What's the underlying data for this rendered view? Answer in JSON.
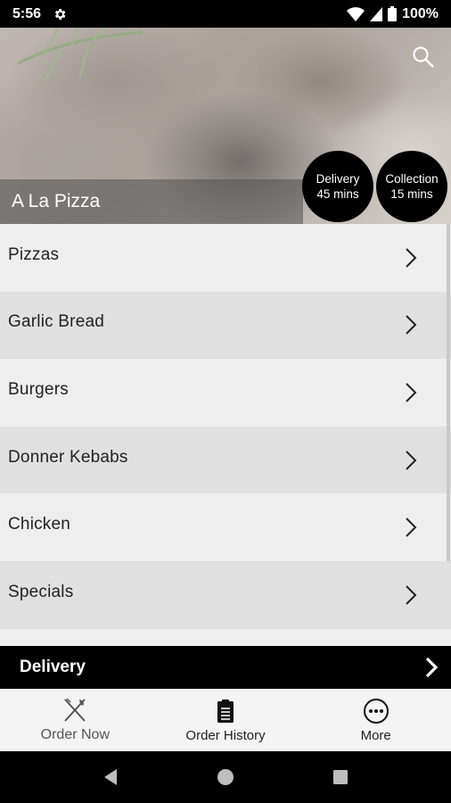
{
  "status_bar": {
    "time": "5:56",
    "battery": "100%",
    "icons": [
      "gear-icon",
      "wifi-icon",
      "signal-icon",
      "battery-icon"
    ]
  },
  "hero": {
    "restaurant_name": "A La Pizza",
    "delivery_badge": {
      "label": "Delivery",
      "time": "45 mins"
    },
    "collection_badge": {
      "label": "Collection",
      "time": "15 mins"
    },
    "icons": [
      "search-icon"
    ]
  },
  "menu": {
    "items": [
      {
        "label": "Pizzas"
      },
      {
        "label": "Garlic Bread"
      },
      {
        "label": "Burgers"
      },
      {
        "label": "Donner Kebabs"
      },
      {
        "label": "Chicken"
      },
      {
        "label": "Specials"
      },
      {
        "label": ""
      }
    ]
  },
  "order_mode": {
    "label": "Delivery"
  },
  "bottom_nav": {
    "items": [
      {
        "label": "Order Now",
        "icon": "fork-knife-icon",
        "active": false
      },
      {
        "label": "Order History",
        "icon": "clipboard-icon",
        "active": true
      },
      {
        "label": "More",
        "icon": "more-icon",
        "active": true
      }
    ]
  },
  "colors": {
    "black": "#000000",
    "list_light": "#eeeeee",
    "list_dark": "#e0e0e0",
    "nav_bg": "#f4f4f4"
  }
}
